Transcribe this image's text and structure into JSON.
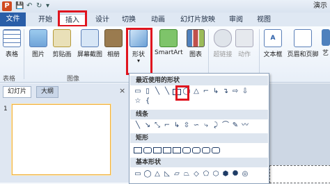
{
  "window": {
    "app_icon_letter": "P",
    "title_fragment": "演示",
    "quick_access": [
      "save-icon",
      "undo-icon",
      "redo-icon",
      "customize-icon"
    ]
  },
  "tabs": [
    {
      "label": "文件",
      "name": "tab-file"
    },
    {
      "label": "开始",
      "name": "tab-home"
    },
    {
      "label": "插入",
      "name": "tab-insert"
    },
    {
      "label": "设计",
      "name": "tab-design"
    },
    {
      "label": "切换",
      "name": "tab-transitions"
    },
    {
      "label": "动画",
      "name": "tab-animations"
    },
    {
      "label": "幻灯片放映",
      "name": "tab-slideshow"
    },
    {
      "label": "审阅",
      "name": "tab-review"
    },
    {
      "label": "视图",
      "name": "tab-view"
    }
  ],
  "ribbon": {
    "buttons": [
      {
        "label": "表格",
        "name": "table-button",
        "icon": "table-icon"
      },
      {
        "label": "图片",
        "name": "picture-button",
        "icon": "picture-icon"
      },
      {
        "label": "剪贴画",
        "name": "clipart-button",
        "icon": "clipart-icon"
      },
      {
        "label": "屏幕截图",
        "name": "screenshot-button",
        "icon": "screenshot-icon"
      },
      {
        "label": "相册",
        "name": "album-button",
        "icon": "album-icon"
      },
      {
        "label": "形状",
        "name": "shapes-button",
        "icon": "shapes-icon"
      },
      {
        "label": "SmartArt",
        "name": "smartart-button",
        "icon": "smartart-icon"
      },
      {
        "label": "图表",
        "name": "chart-button",
        "icon": "chart-icon"
      },
      {
        "label": "超链接",
        "name": "hyperlink-button",
        "icon": "hyperlink-icon"
      },
      {
        "label": "动作",
        "name": "action-button",
        "icon": "action-icon"
      },
      {
        "label": "文本框",
        "name": "textbox-button",
        "icon": "textbox-icon"
      },
      {
        "label": "页眉和页脚",
        "name": "header-footer-button",
        "icon": "header-footer-icon"
      },
      {
        "label": "艺",
        "name": "wordart-button",
        "icon": "wordart-icon"
      }
    ],
    "groups": [
      "表格",
      "图像"
    ]
  },
  "left_pane": {
    "tab_slides": "幻灯片",
    "tab_outline": "大纲",
    "close_symbol": "×",
    "slide_number": "1"
  },
  "shapes_menu": {
    "sections": [
      "最近使用的形状",
      "线条",
      "矩形",
      "基本形状"
    ]
  },
  "colors": {
    "accent": "#2a5ea8",
    "highlight": "#e0141e",
    "shape_stroke": "#1f3c66"
  }
}
